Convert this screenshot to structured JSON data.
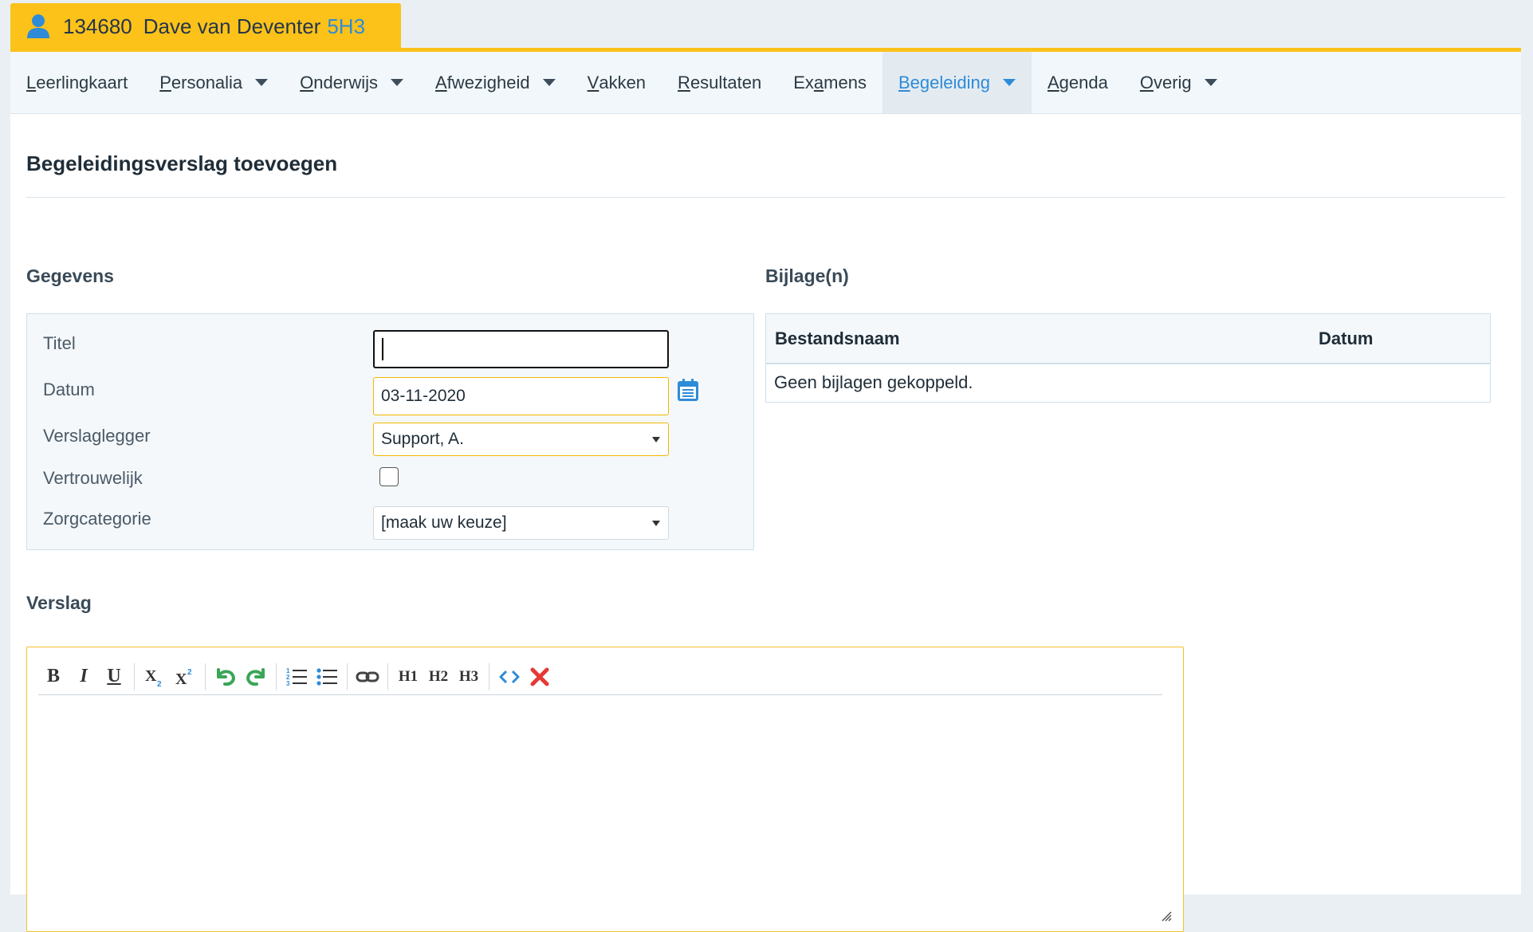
{
  "student": {
    "id": "134680",
    "name": "Dave van Deventer",
    "class": "5H3"
  },
  "nav": {
    "items": [
      {
        "first": "L",
        "rest": "eerlingkaart",
        "dropdown": false,
        "active": false
      },
      {
        "first": "P",
        "rest": "ersonalia",
        "dropdown": true,
        "active": false
      },
      {
        "first": "O",
        "rest": "nderwijs",
        "dropdown": true,
        "active": false
      },
      {
        "first": "A",
        "rest": "fwezigheid",
        "dropdown": true,
        "active": false
      },
      {
        "first": "V",
        "rest": "akken",
        "dropdown": false,
        "active": false
      },
      {
        "first": "R",
        "rest": "esultaten",
        "dropdown": false,
        "active": false
      },
      {
        "first": "Ex",
        "ul": "a",
        "rest": "mens",
        "dropdown": false,
        "active": false
      },
      {
        "first": "B",
        "rest": "egeleiding",
        "dropdown": true,
        "active": true
      },
      {
        "first": "A",
        "rest": "genda",
        "dropdown": false,
        "active": false
      },
      {
        "first": "O",
        "rest": "verig",
        "dropdown": true,
        "active": false
      }
    ]
  },
  "page": {
    "title": "Begeleidingsverslag toevoegen"
  },
  "gegevens": {
    "heading": "Gegevens",
    "titel_label": "Titel",
    "titel_value": "",
    "datum_label": "Datum",
    "datum_value": "03-11-2020",
    "verslaglegger_label": "Verslaglegger",
    "verslaglegger_value": "Support, A.",
    "vertrouwelijk_label": "Vertrouwelijk",
    "vertrouwelijk_checked": false,
    "zorgcategorie_label": "Zorgcategorie",
    "zorgcategorie_value": "[maak uw keuze]"
  },
  "bijlagen": {
    "heading": "Bijlage(n)",
    "col_name": "Bestandsnaam",
    "col_date": "Datum",
    "empty_text": "Geen bijlagen gekoppeld."
  },
  "verslag": {
    "heading": "Verslag",
    "toolbar": {
      "bold": "B",
      "italic": "I",
      "underline": "U",
      "h1": "H1",
      "h2": "H2",
      "h3": "H3"
    },
    "content": ""
  },
  "colors": {
    "accent_yellow": "#fcc219",
    "link_blue": "#2e8bd8",
    "undo_green": "#3aa657",
    "delete_red": "#e53935"
  }
}
